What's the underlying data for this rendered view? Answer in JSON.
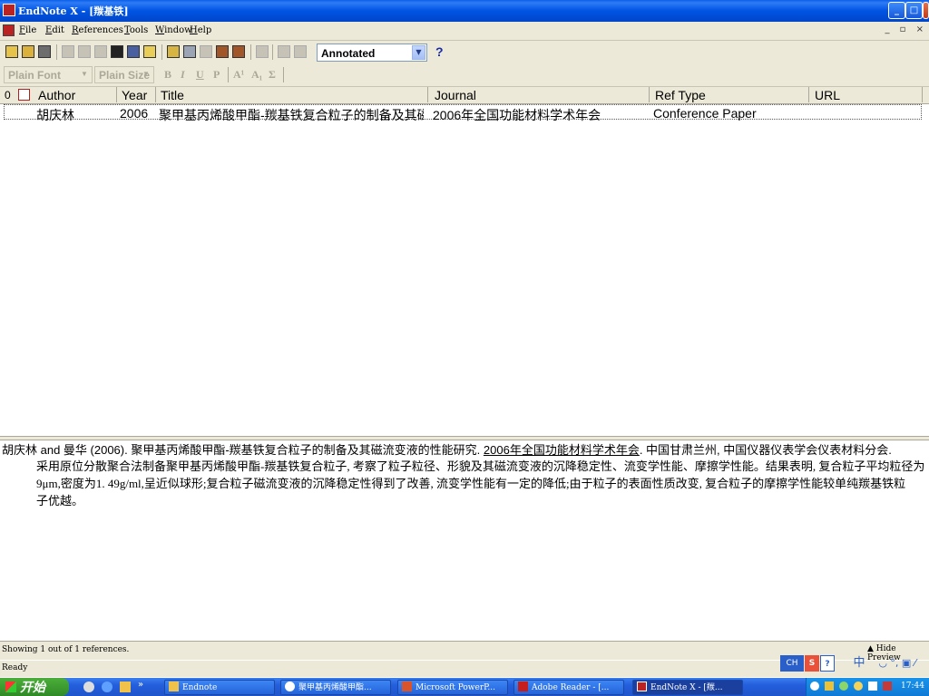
{
  "window": {
    "title": "EndNote X - [羰基铁]",
    "controls": [
      "_",
      "□",
      "X"
    ]
  },
  "menu": [
    "File",
    "Edit",
    "References",
    "Tools",
    "Window",
    "Help"
  ],
  "toolbar": {
    "style_value": "Annotated",
    "help_label": "?"
  },
  "format_bar": {
    "font_value": "Plain Font",
    "size_value": "Plain Size",
    "buttons": [
      "B",
      "I",
      "U",
      "P",
      "A¹",
      "A₁",
      "Σ"
    ]
  },
  "columns": {
    "paperclip": "0",
    "author": "Author",
    "year": "Year",
    "title": "Title",
    "journal": "Journal",
    "ref_type": "Ref Type",
    "url": "URL"
  },
  "references": [
    {
      "author": "胡庆林",
      "year": "2006",
      "title": "聚甲基丙烯酸甲酯-羰基铁复合粒子的制备及其磁...",
      "journal": "2006年全国功能材料学术年会",
      "ref_type": "Conference Paper",
      "url": ""
    }
  ],
  "preview": {
    "citation_prefix": "胡庆林 and 曼华 (2006). 聚甲基丙烯酸甲酯-羰基铁复合粒子的制备及其磁流变液的性能研究.",
    "citation_journal": "2006年全国功能材料学术年会",
    "citation_suffix": ". 中国甘肃兰州, 中国仪器仪表学会仪表材料分会.",
    "abstract_line1": "采用原位分散聚合法制备聚甲基丙烯酸甲酯-羰基铁复合粒子, 考察了粒子粒径、形貌及其磁流变液的沉降稳定性、流变学性能、摩擦学性能。结果表明, 复合粒子平均粒径为",
    "abstract_line2": "9μm,密度为1. 49g/ml,呈近似球形;复合粒子磁流变液的沉降稳定性得到了改善, 流变学性能有一定的降低;由于粒子的表面性质改变, 复合粒子的摩擦学性能较单纯羰基铁粒",
    "abstract_line3": "子优越。"
  },
  "status": {
    "count_text": "Showing 1 out of 1 references.",
    "ready_text": "Ready",
    "hide_preview": "Hide Preview"
  },
  "ime": {
    "lang": "CH",
    "logo": "S",
    "help": "?",
    "mode": "中"
  },
  "taskbar": {
    "start": "开始",
    "tasks": [
      "Endnote",
      "聚甲基丙烯酸甲酯...",
      "Microsoft PowerP...",
      "Adobe Reader - [...",
      "EndNote X - [羰..."
    ],
    "clock": "17:44"
  },
  "colors": {
    "title_blue": "#0054e3",
    "chrome": "#ece9d8",
    "start_green": "#2f8a26",
    "taskbar_blue": "#245edb"
  }
}
